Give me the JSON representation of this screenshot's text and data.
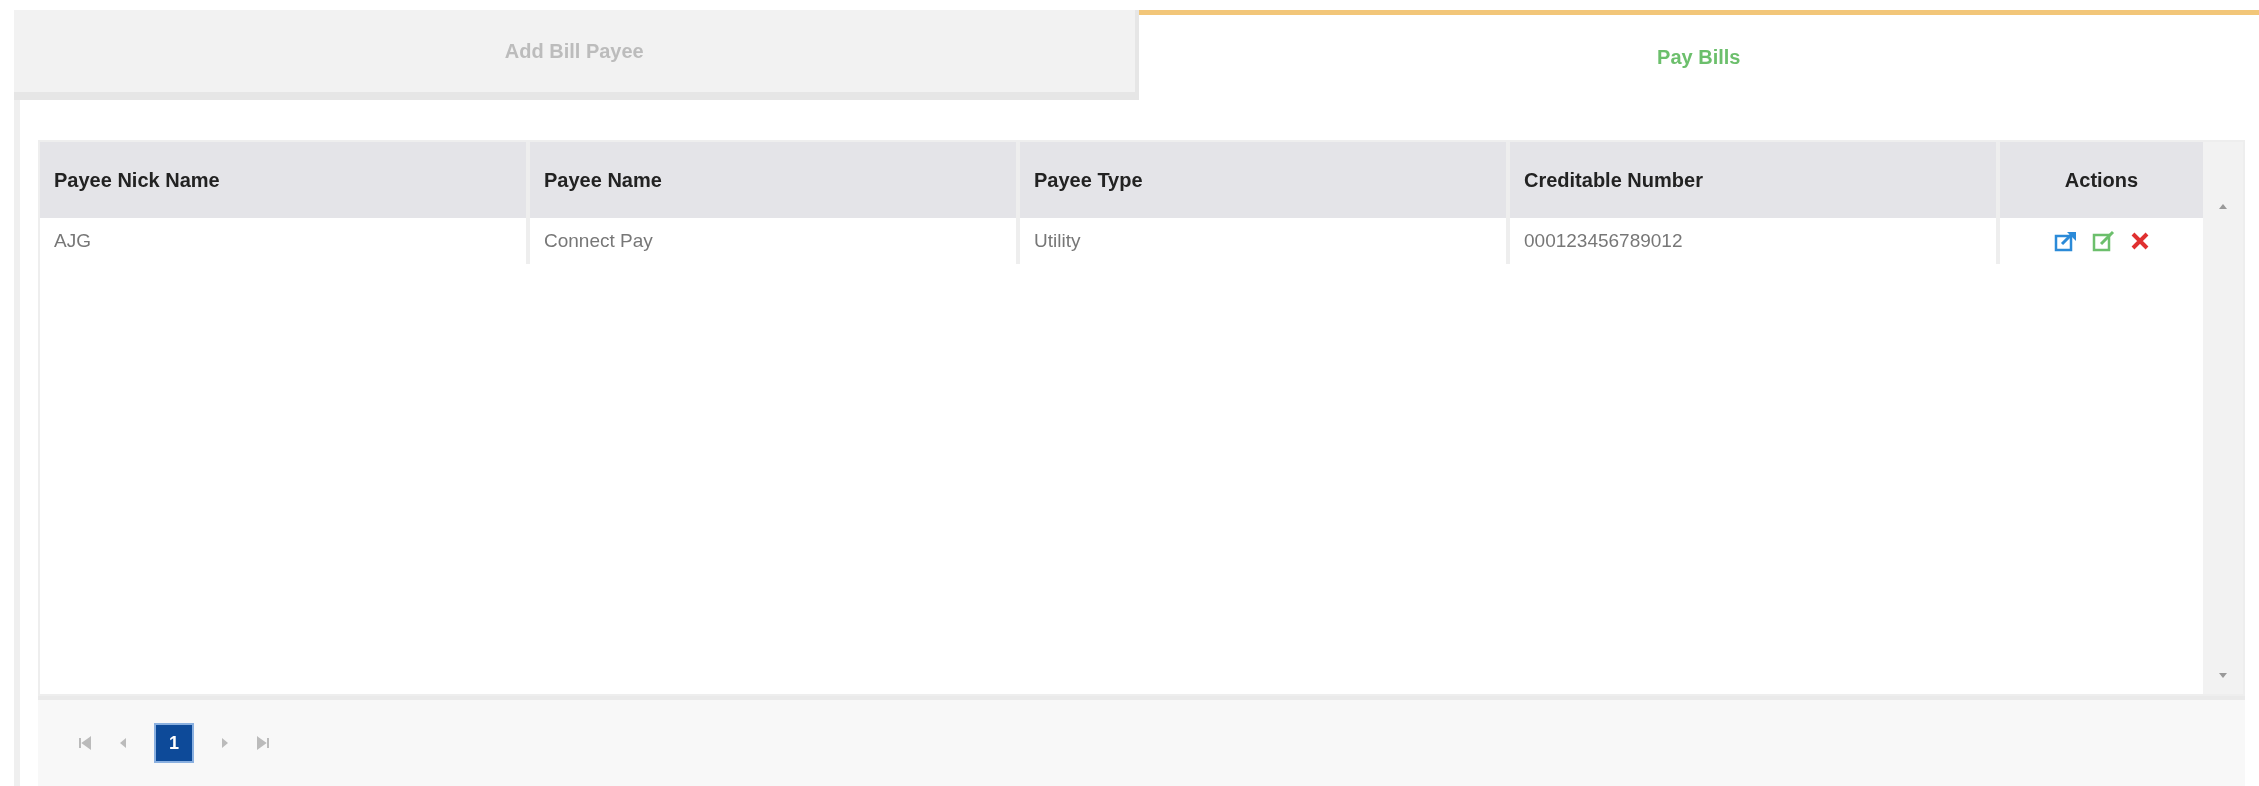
{
  "tabs": [
    {
      "label": "Add Bill Payee",
      "selected": false
    },
    {
      "label": "Pay Bills",
      "selected": true
    }
  ],
  "table": {
    "columns": [
      "Payee Nick Name",
      "Payee Name",
      "Payee Type",
      "Creditable Number",
      "Actions"
    ],
    "rows": [
      {
        "cells": [
          "AJG",
          "Connect Pay",
          "Utility",
          "000123456789012"
        ]
      }
    ]
  },
  "pager": {
    "pages": [
      {
        "label": "1",
        "selected": true
      }
    ]
  }
}
